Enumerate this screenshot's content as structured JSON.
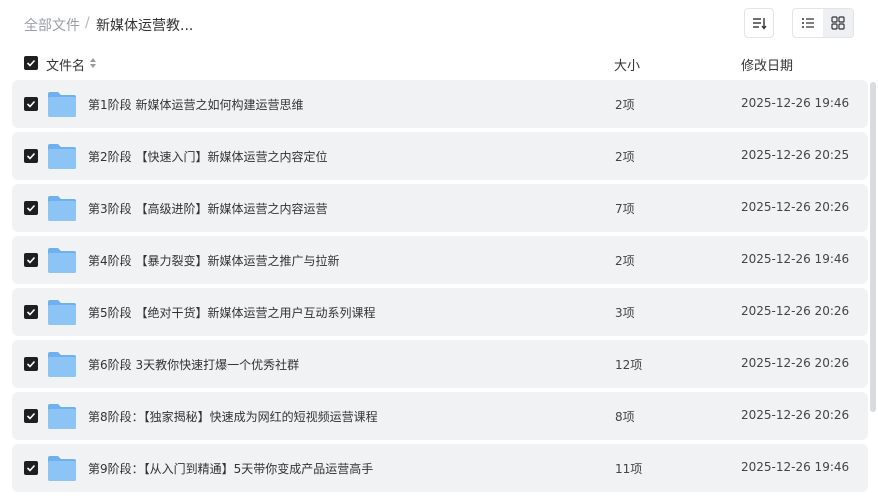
{
  "breadcrumb": {
    "root": "全部文件",
    "separator": "/",
    "current": "新媒体运营教..."
  },
  "toolbar": {
    "sort_icon": "sort-list-icon",
    "list_view_icon": "list-view-icon",
    "grid_view_icon": "grid-view-icon"
  },
  "columns": {
    "name": "文件名",
    "size": "大小",
    "modified": "修改日期"
  },
  "colors": {
    "row_bg": "#f1f2f4",
    "folder_blue": "#7cb8f0",
    "checkbox": "#1f1f1f"
  },
  "files": [
    {
      "name": "第1阶段 新媒体运营之如何构建运营思维",
      "size": "2项",
      "date": "2025-12-26 19:46"
    },
    {
      "name": "第2阶段 【快速入门】新媒体运营之内容定位",
      "size": "2项",
      "date": "2025-12-26 20:25"
    },
    {
      "name": "第3阶段 【高级进阶】新媒体运营之内容运营",
      "size": "7项",
      "date": "2025-12-26 20:26"
    },
    {
      "name": "第4阶段 【暴力裂变】新媒体运营之推广与拉新",
      "size": "2项",
      "date": "2025-12-26 19:46"
    },
    {
      "name": "第5阶段 【绝对干货】新媒体运营之用户互动系列课程",
      "size": "3项",
      "date": "2025-12-26 20:26"
    },
    {
      "name": "第6阶段 3天教你快速打爆一个优秀社群",
      "size": "12项",
      "date": "2025-12-26 20:26"
    },
    {
      "name": "第8阶段：【独家揭秘】快速成为网红的短视频运营课程",
      "size": "8项",
      "date": "2025-12-26 20:26"
    },
    {
      "name": "第9阶段：【从入门到精通】5天带你变成产品运营高手",
      "size": "11项",
      "date": "2025-12-26 19:46"
    }
  ]
}
